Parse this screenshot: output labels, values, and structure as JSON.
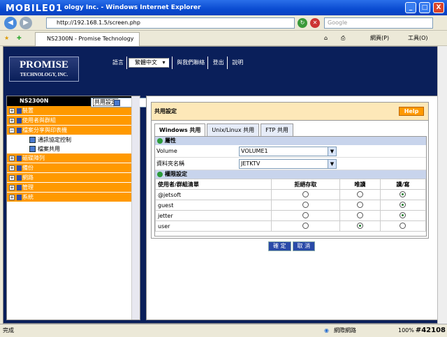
{
  "window": {
    "title_prefix": "ology Inc. - Windows Internet Explorer",
    "logo_text": "MOBILE01",
    "min": "_",
    "max": "□",
    "close": "X"
  },
  "browser": {
    "url": "http://192.168.1.5/screen.php",
    "search_placeholder": "Google",
    "tab_title": "NS2300N - Promise Technology Inc.",
    "tools": [
      "網頁(P)",
      "工具(O)"
    ]
  },
  "header": {
    "brand_line1": "PROMISE",
    "brand_line2": "TECHNOLOGY, INC.",
    "lang_label": "語言",
    "lang_value": "繁體中文",
    "nav": [
      "與我們聯絡",
      "登出",
      "說明"
    ]
  },
  "sidebar": {
    "title": "NS2300N",
    "items": [
      {
        "label": "裝置"
      },
      {
        "label": "使用者與群組"
      },
      {
        "label": "檔案分享與印表機"
      }
    ],
    "subitems": [
      {
        "label": "通訊協定控制"
      },
      {
        "label": "檔案共用"
      },
      {
        "label": "共用設定"
      }
    ],
    "items2": [
      {
        "label": "磁碟陣列"
      },
      {
        "label": "備份"
      },
      {
        "label": "網路"
      },
      {
        "label": "管理"
      },
      {
        "label": "系統"
      }
    ]
  },
  "panel": {
    "title": "共用設定",
    "help": "Help",
    "tabs": [
      "Windows 共用",
      "Unix/Linux 共用",
      "FTP 共用"
    ],
    "attr_section": "屬性",
    "fields": [
      {
        "label": "Volume",
        "value": "VOLUME1"
      },
      {
        "label": "資料夾名稱",
        "value": "JETKTV"
      }
    ],
    "perm_section": "權限設定",
    "columns": [
      "使用者/群組清單",
      "拒絕存取",
      "唯讀",
      "讀/寫"
    ],
    "rows": [
      {
        "name": "@jetsoft",
        "sel": 3
      },
      {
        "name": "guest",
        "sel": 3
      },
      {
        "name": "jetter",
        "sel": 3
      },
      {
        "name": "user",
        "sel": 2
      }
    ],
    "ok": "確 定",
    "cancel": "取 消"
  },
  "status": {
    "left": "完成",
    "zone": "網際網路",
    "zoom": "100%",
    "watermark": "#42108"
  }
}
